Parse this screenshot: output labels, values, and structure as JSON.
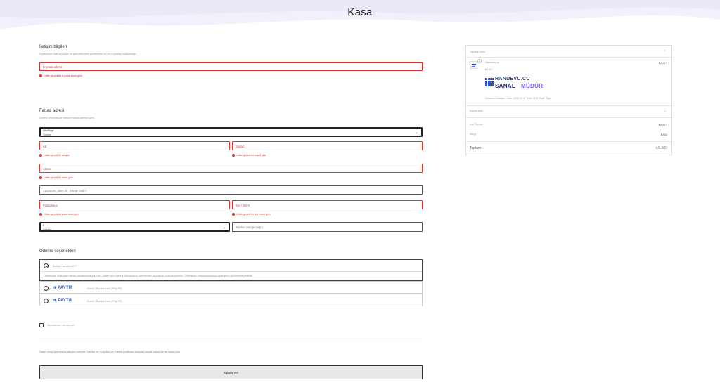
{
  "page": {
    "title": "Kasa"
  },
  "contact": {
    "title": "İletişim bilgileri",
    "subtitle": "Siparişinizle ilgili ayrıntıları ve güncellemeleri göndermek için bu e-postayı kullanacağız.",
    "email_placeholder": "E-posta adresi",
    "email_error": "Lütfen geçerli bir e-posta adresi girin"
  },
  "billing": {
    "title": "Fatura adresi",
    "subtitle": "Ödeme yönteminizle eşleşen fatura adresini girin.",
    "country_label": "Ülke/Bölge",
    "country_value": "Türkiye",
    "first_name": "Ad",
    "first_name_error": "Lütfen geçerli bir ad girin",
    "last_name": "Soyad",
    "last_name_error": "Lütfen geçerli bir soyad girin",
    "address": "Adres",
    "address_error": "Lütfen geçerli bir adres girin",
    "apartment": "Apartman, daire vb. (isteğe bağlı)",
    "postcode": "Posta kodu",
    "postcode_error": "Lütfen geçerli bir posta kodu girin",
    "city": "İlçe / Semt",
    "city_error": "Lütfen geçerli bir ilçe / semt girin",
    "province_label": "İl",
    "province_value": "İstanbul",
    "phone": "Telefon (isteğe bağlı)"
  },
  "payment": {
    "title": "Ödeme seçenekleri",
    "bank_label": "Banka havalesi/EFT",
    "bank_note": "Ödemenizi doğrudan banka hesabımıza yapınız. Lütfen ilgili Sipariş Numarasını ödemenizin açıklama kısmına yazınız. Ödemeniz onaylanmadıkça siparişiniz gönderilmeyecektir.",
    "paytr_logo": "PAYTR",
    "option2": "Kredi / Banka Kartı (PayTR)",
    "option3": "Kredi / Banka Kartı (PayTR)"
  },
  "order_note": "Siparişinize not ekleyin",
  "terms": "Satın alma işleminizle devam ederek, Şartlar ve Koşullar ve Gizlilik politikası koşullarımızla kabul etmiş olursunuz",
  "place_order": "Sipariş Ver",
  "summary": {
    "title": "Sipariş özeti",
    "qty": "1",
    "product_name": "Randevu.cc",
    "product_price": "₺4.417",
    "product_price_small": "₺4.417",
    "logo_top": "RANDEVU.CC",
    "logo_bottom_a": "SANAL",
    "logo_bottom_b": "MÜDÜR",
    "details": "Randevu Detayları : Date: 2025-01-02 Time: 09:00 Staff: Figen",
    "coupon": "Kupon ekle",
    "subtotal_label": "Ara Toplam",
    "subtotal_value": "₺4.417",
    "tax_label": "Vergi",
    "tax_value": "₺883",
    "total_label": "Toplam",
    "total_value": "₺5.300"
  },
  "colors": {
    "error": "#cc3333",
    "brand": "#1d4fa3",
    "accent_purple": "#7b5cff"
  }
}
